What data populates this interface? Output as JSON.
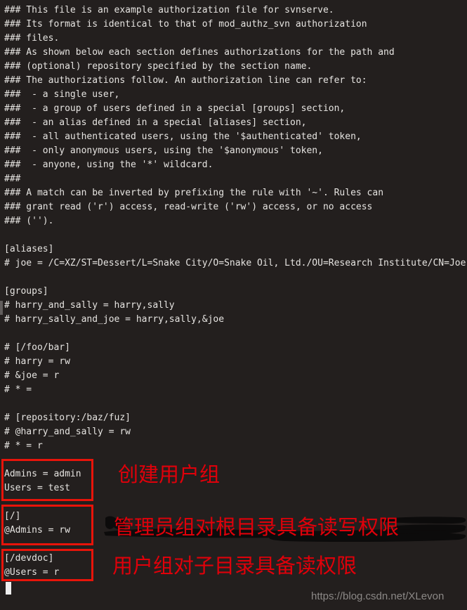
{
  "editor": {
    "background_color": "#231f1e",
    "text_color": "#e6e4e1",
    "lines": [
      "### This file is an example authorization file for svnserve.",
      "### Its format is identical to that of mod_authz_svn authorization",
      "### files.",
      "### As shown below each section defines authorizations for the path and",
      "### (optional) repository specified by the section name.",
      "### The authorizations follow. An authorization line can refer to:",
      "###  - a single user,",
      "###  - a group of users defined in a special [groups] section,",
      "###  - an alias defined in a special [aliases] section,",
      "###  - all authenticated users, using the '$authenticated' token,",
      "###  - only anonymous users, using the '$anonymous' token,",
      "###  - anyone, using the '*' wildcard.",
      "###",
      "### A match can be inverted by prefixing the rule with '~'. Rules can",
      "### grant read ('r') access, read-write ('rw') access, or no access",
      "### ('').",
      "",
      "[aliases]",
      "# joe = /C=XZ/ST=Dessert/L=Snake City/O=Snake Oil, Ltd./OU=Research Institute/CN=Joe Average",
      "",
      "[groups]",
      "# harry_and_sally = harry,sally",
      "# harry_sally_and_joe = harry,sally,&joe",
      "",
      "# [/foo/bar]",
      "# harry = rw",
      "# &joe = r",
      "# * =",
      "",
      "# [repository:/baz/fuz]",
      "# @harry_and_sally = rw",
      "# * = r",
      "",
      "Admins = admin",
      "Users = test",
      "",
      "[/]",
      "@Admins = rw",
      "",
      "[/devdoc]",
      "@Users = r"
    ]
  },
  "annotations": {
    "color": "#e0000a",
    "box_color": "#e8140a",
    "items": [
      {
        "text": "创建用户组"
      },
      {
        "text": "管理员组对根目录具备读写权限"
      },
      {
        "text": "用户组对子目录具备读权限"
      }
    ]
  },
  "watermark": {
    "text": "https://blog.csdn.net/XLevon"
  }
}
